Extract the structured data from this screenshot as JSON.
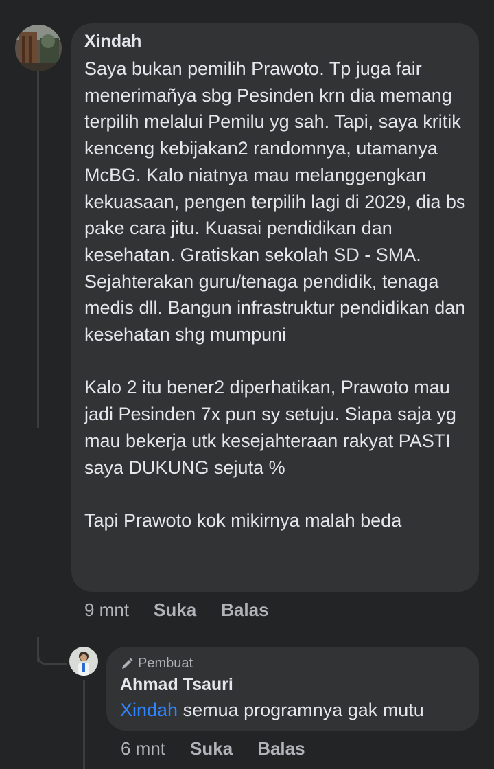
{
  "comment": {
    "author": "Xindah",
    "paragraphs": [
      "Saya bukan pemilih Prawoto. Tp juga fair menerimañya sbg Pesinden krn dia memang terpilih melalui Pemilu yg sah. Tapi, saya kritik kenceng kebijakan2 randomnya, utamanya McBG. Kalo niatnya mau melanggengkan kekuasaan, pengen terpilih lagi di 2029, dia bs pake cara jitu. Kuasai pendidikan dan kesehatan. Gratiskan sekolah SD - SMA. Sejahterakan guru/tenaga pendidik, tenaga medis dll. Bangun infrastruktur pendidikan dan kesehatan shg mumpuni",
      "Kalo 2 itu bener2 diperhatikan, Prawoto mau jadi Pesinden 7x pun sy setuju. Siapa saja yg mau bekerja utk kesejahteraan rakyat PASTI saya DUKUNG sejuta %",
      "Tapi Prawoto kok mikirnya malah beda"
    ],
    "time": "9 mnt",
    "like_label": "Suka",
    "reply_label": "Balas"
  },
  "reply": {
    "badge_label": "Pembuat",
    "badge_icon": "pencil-icon",
    "author": "Ahmad Tsauri",
    "mention": "Xindah",
    "text": " semua programnya gak mutu",
    "time": "6 mnt",
    "like_label": "Suka",
    "reply_label": "Balas"
  },
  "colors": {
    "background": "#232425",
    "bubble": "#323335",
    "text": "#e4e6eb",
    "secondary_text": "#b0b3b8",
    "mention": "#2d86ff"
  }
}
